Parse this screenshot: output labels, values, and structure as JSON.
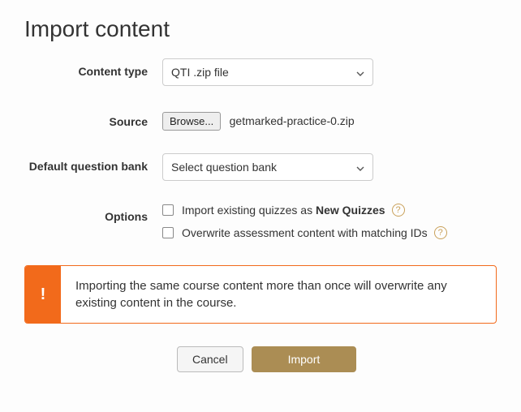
{
  "page": {
    "title": "Import content"
  },
  "labels": {
    "content_type": "Content type",
    "source": "Source",
    "default_question_bank": "Default question bank",
    "options": "Options"
  },
  "content_type": {
    "selected": "QTI .zip file"
  },
  "source": {
    "browse_label": "Browse...",
    "filename": "getmarked-practice-0.zip"
  },
  "question_bank": {
    "selected": "Select question bank"
  },
  "options": {
    "import_quizzes_prefix": "Import existing quizzes as ",
    "import_quizzes_bold": "New Quizzes",
    "overwrite_ids": "Overwrite assessment content with matching IDs"
  },
  "alert": {
    "icon": "!",
    "text": "Importing the same course content more than once will overwrite any existing content in the course."
  },
  "buttons": {
    "cancel": "Cancel",
    "import": "Import"
  }
}
